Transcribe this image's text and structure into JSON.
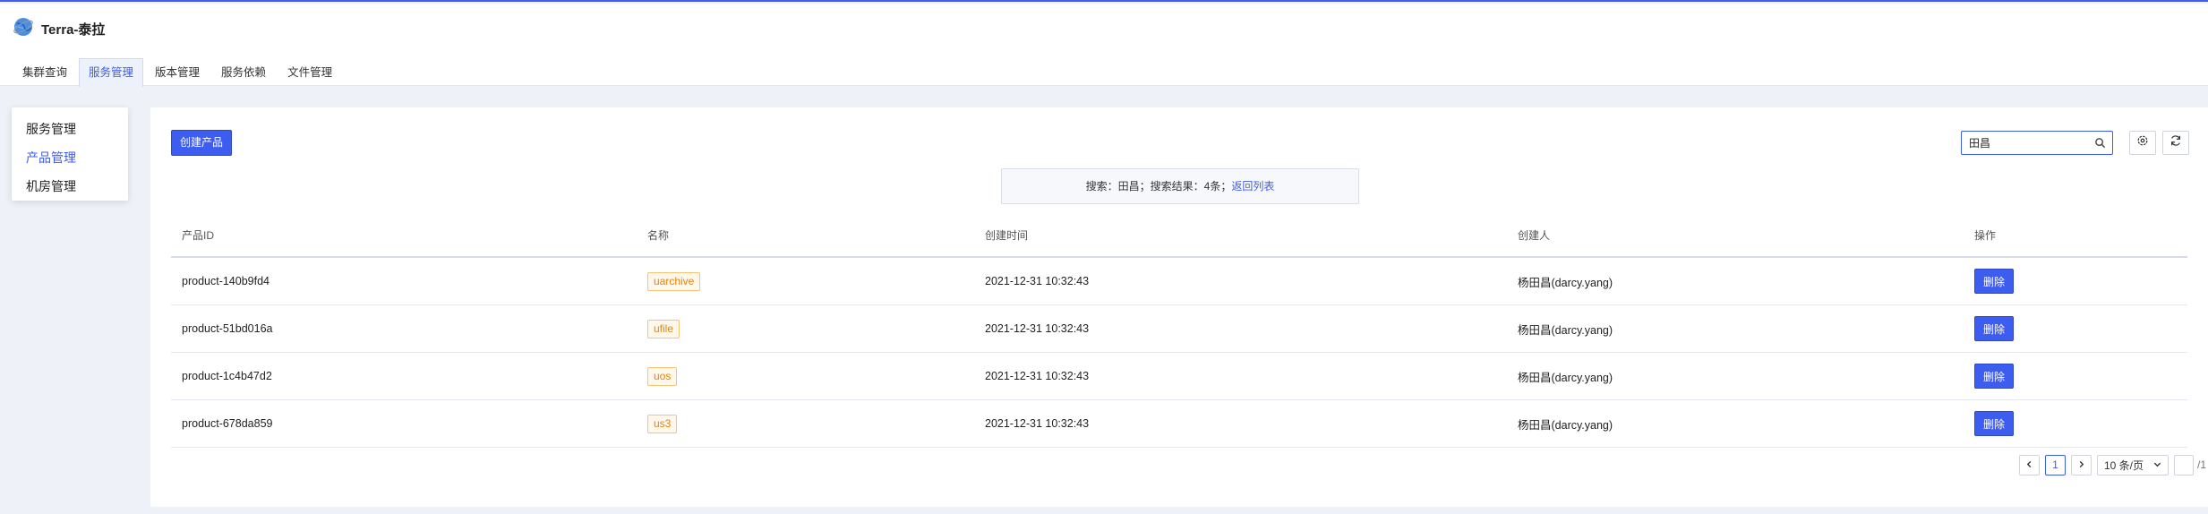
{
  "app": {
    "title": "Terra-泰拉"
  },
  "nav": {
    "tabs": [
      {
        "label": "集群查询",
        "active": false
      },
      {
        "label": "服务管理",
        "active": true
      },
      {
        "label": "版本管理",
        "active": false
      },
      {
        "label": "服务依赖",
        "active": false
      },
      {
        "label": "文件管理",
        "active": false
      }
    ]
  },
  "sidebar": {
    "items": [
      {
        "label": "服务管理",
        "active": false
      },
      {
        "label": "产品管理",
        "active": true
      },
      {
        "label": "机房管理",
        "active": false
      }
    ]
  },
  "toolbar": {
    "create_label": "创建产品",
    "search_value": "田昌"
  },
  "search_result": {
    "prefix": "搜索：田昌；搜索结果：4条；",
    "back_link": "返回列表"
  },
  "table": {
    "headers": [
      "产品ID",
      "名称",
      "创建时间",
      "创建人",
      "操作"
    ],
    "rows": [
      {
        "id": "product-140b9fd4",
        "name": "uarchive",
        "created": "2021-12-31 10:32:43",
        "creator": "杨田昌(darcy.yang)",
        "action": "删除"
      },
      {
        "id": "product-51bd016a",
        "name": "ufile",
        "created": "2021-12-31 10:32:43",
        "creator": "杨田昌(darcy.yang)",
        "action": "删除"
      },
      {
        "id": "product-1c4b47d2",
        "name": "uos",
        "created": "2021-12-31 10:32:43",
        "creator": "杨田昌(darcy.yang)",
        "action": "删除"
      },
      {
        "id": "product-678da859",
        "name": "us3",
        "created": "2021-12-31 10:32:43",
        "creator": "杨田昌(darcy.yang)",
        "action": "删除"
      }
    ]
  },
  "pagination": {
    "current_page": "1",
    "page_size": "10 条/页",
    "total_pages": "/1"
  },
  "colors": {
    "accent": "#3d5cf0",
    "tag_text": "#e6830d",
    "tag_border": "#f5c477"
  }
}
